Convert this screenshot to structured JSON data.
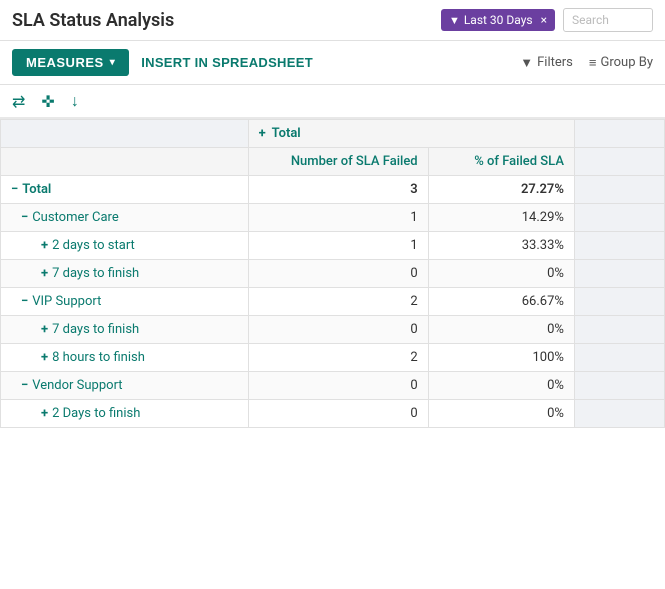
{
  "header": {
    "title": "SLA Status Analysis",
    "filter_chip_label": "Last 30 Days",
    "search_placeholder": "Search"
  },
  "toolbar": {
    "measures_label": "MEASURES",
    "insert_label": "INSERT IN SPREADSHEET",
    "filters_label": "Filters",
    "group_by_label": "Group By"
  },
  "icons": {
    "transfer": "⇄",
    "move": "✛",
    "download": "⬇",
    "funnel": "▼",
    "layers": "≡",
    "chevron": "▾",
    "plus": "＋",
    "minus": "－",
    "close": "×"
  },
  "table": {
    "col_group_header": "Total",
    "col1_header": "Number of SLA Failed",
    "col2_header": "% of Failed SLA",
    "rows": [
      {
        "label": "Total",
        "level": 0,
        "expand": "minus",
        "col1": "3",
        "col2": "27.27%",
        "teal": true
      },
      {
        "label": "Customer Care",
        "level": 1,
        "expand": "minus",
        "col1": "1",
        "col2": "14.29%",
        "teal": true
      },
      {
        "label": "2 days to start",
        "level": 2,
        "expand": "plus",
        "col1": "1",
        "col2": "33.33%",
        "teal": true
      },
      {
        "label": "7 days to finish",
        "level": 2,
        "expand": "plus",
        "col1": "0",
        "col2": "0%",
        "teal": true
      },
      {
        "label": "VIP Support",
        "level": 1,
        "expand": "minus",
        "col1": "2",
        "col2": "66.67%",
        "teal": true
      },
      {
        "label": "7 days to finish",
        "level": 2,
        "expand": "plus",
        "col1": "0",
        "col2": "0%",
        "teal": true
      },
      {
        "label": "8 hours to finish",
        "level": 2,
        "expand": "plus",
        "col1": "2",
        "col2": "100%",
        "teal": true
      },
      {
        "label": "Vendor Support",
        "level": 1,
        "expand": "minus",
        "col1": "0",
        "col2": "0%",
        "teal": true
      },
      {
        "label": "2 Days to finish",
        "level": 2,
        "expand": "plus",
        "col1": "0",
        "col2": "0%",
        "teal": true
      }
    ]
  }
}
